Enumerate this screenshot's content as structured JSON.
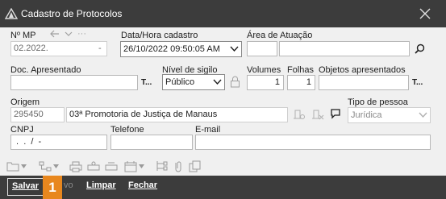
{
  "window": {
    "title": "Cadastro de Protocolos"
  },
  "fields": {
    "nmp": {
      "label": "Nº MP",
      "value": "02.2022.",
      "extra": "-"
    },
    "datahora": {
      "label": "Data/Hora cadastro",
      "value": "26/10/2022 09:50:05 AM"
    },
    "area": {
      "label": "Área de Atuação",
      "value": ""
    },
    "doc": {
      "label": "Doc. Apresentado",
      "value": ""
    },
    "sigilo": {
      "label": "Nível de sigilo",
      "value": "Público"
    },
    "volumes": {
      "label": "Volumes",
      "value": "1"
    },
    "folhas": {
      "label": "Folhas",
      "value": "1"
    },
    "objetos": {
      "label": "Objetos apresentados",
      "value": ""
    },
    "origem": {
      "label": "Origem",
      "code": "295450",
      "name": "03ª Promotoria de Justiça de Manaus"
    },
    "tipo_pessoa": {
      "label": "Tipo de pessoa",
      "value": "Jurídica"
    },
    "cnpj": {
      "label": "CNPJ",
      "value": " .  .  /  -"
    },
    "telefone": {
      "label": "Telefone",
      "value": ""
    },
    "email": {
      "label": "E-mail",
      "value": ""
    }
  },
  "text_button": "T...",
  "bottom": {
    "salvar": "Salvar",
    "badge": "1",
    "novo_partial": "vo",
    "limpar": "Limpar",
    "fechar": "Fechar"
  },
  "icons": [
    "app-icon",
    "close-icon",
    "back-icon",
    "chevron-down-icon",
    "more-icon",
    "search-icon",
    "lock-icon",
    "calendar-icon",
    "pin-icon",
    "folder-icon",
    "print-icon",
    "attach-icon"
  ]
}
